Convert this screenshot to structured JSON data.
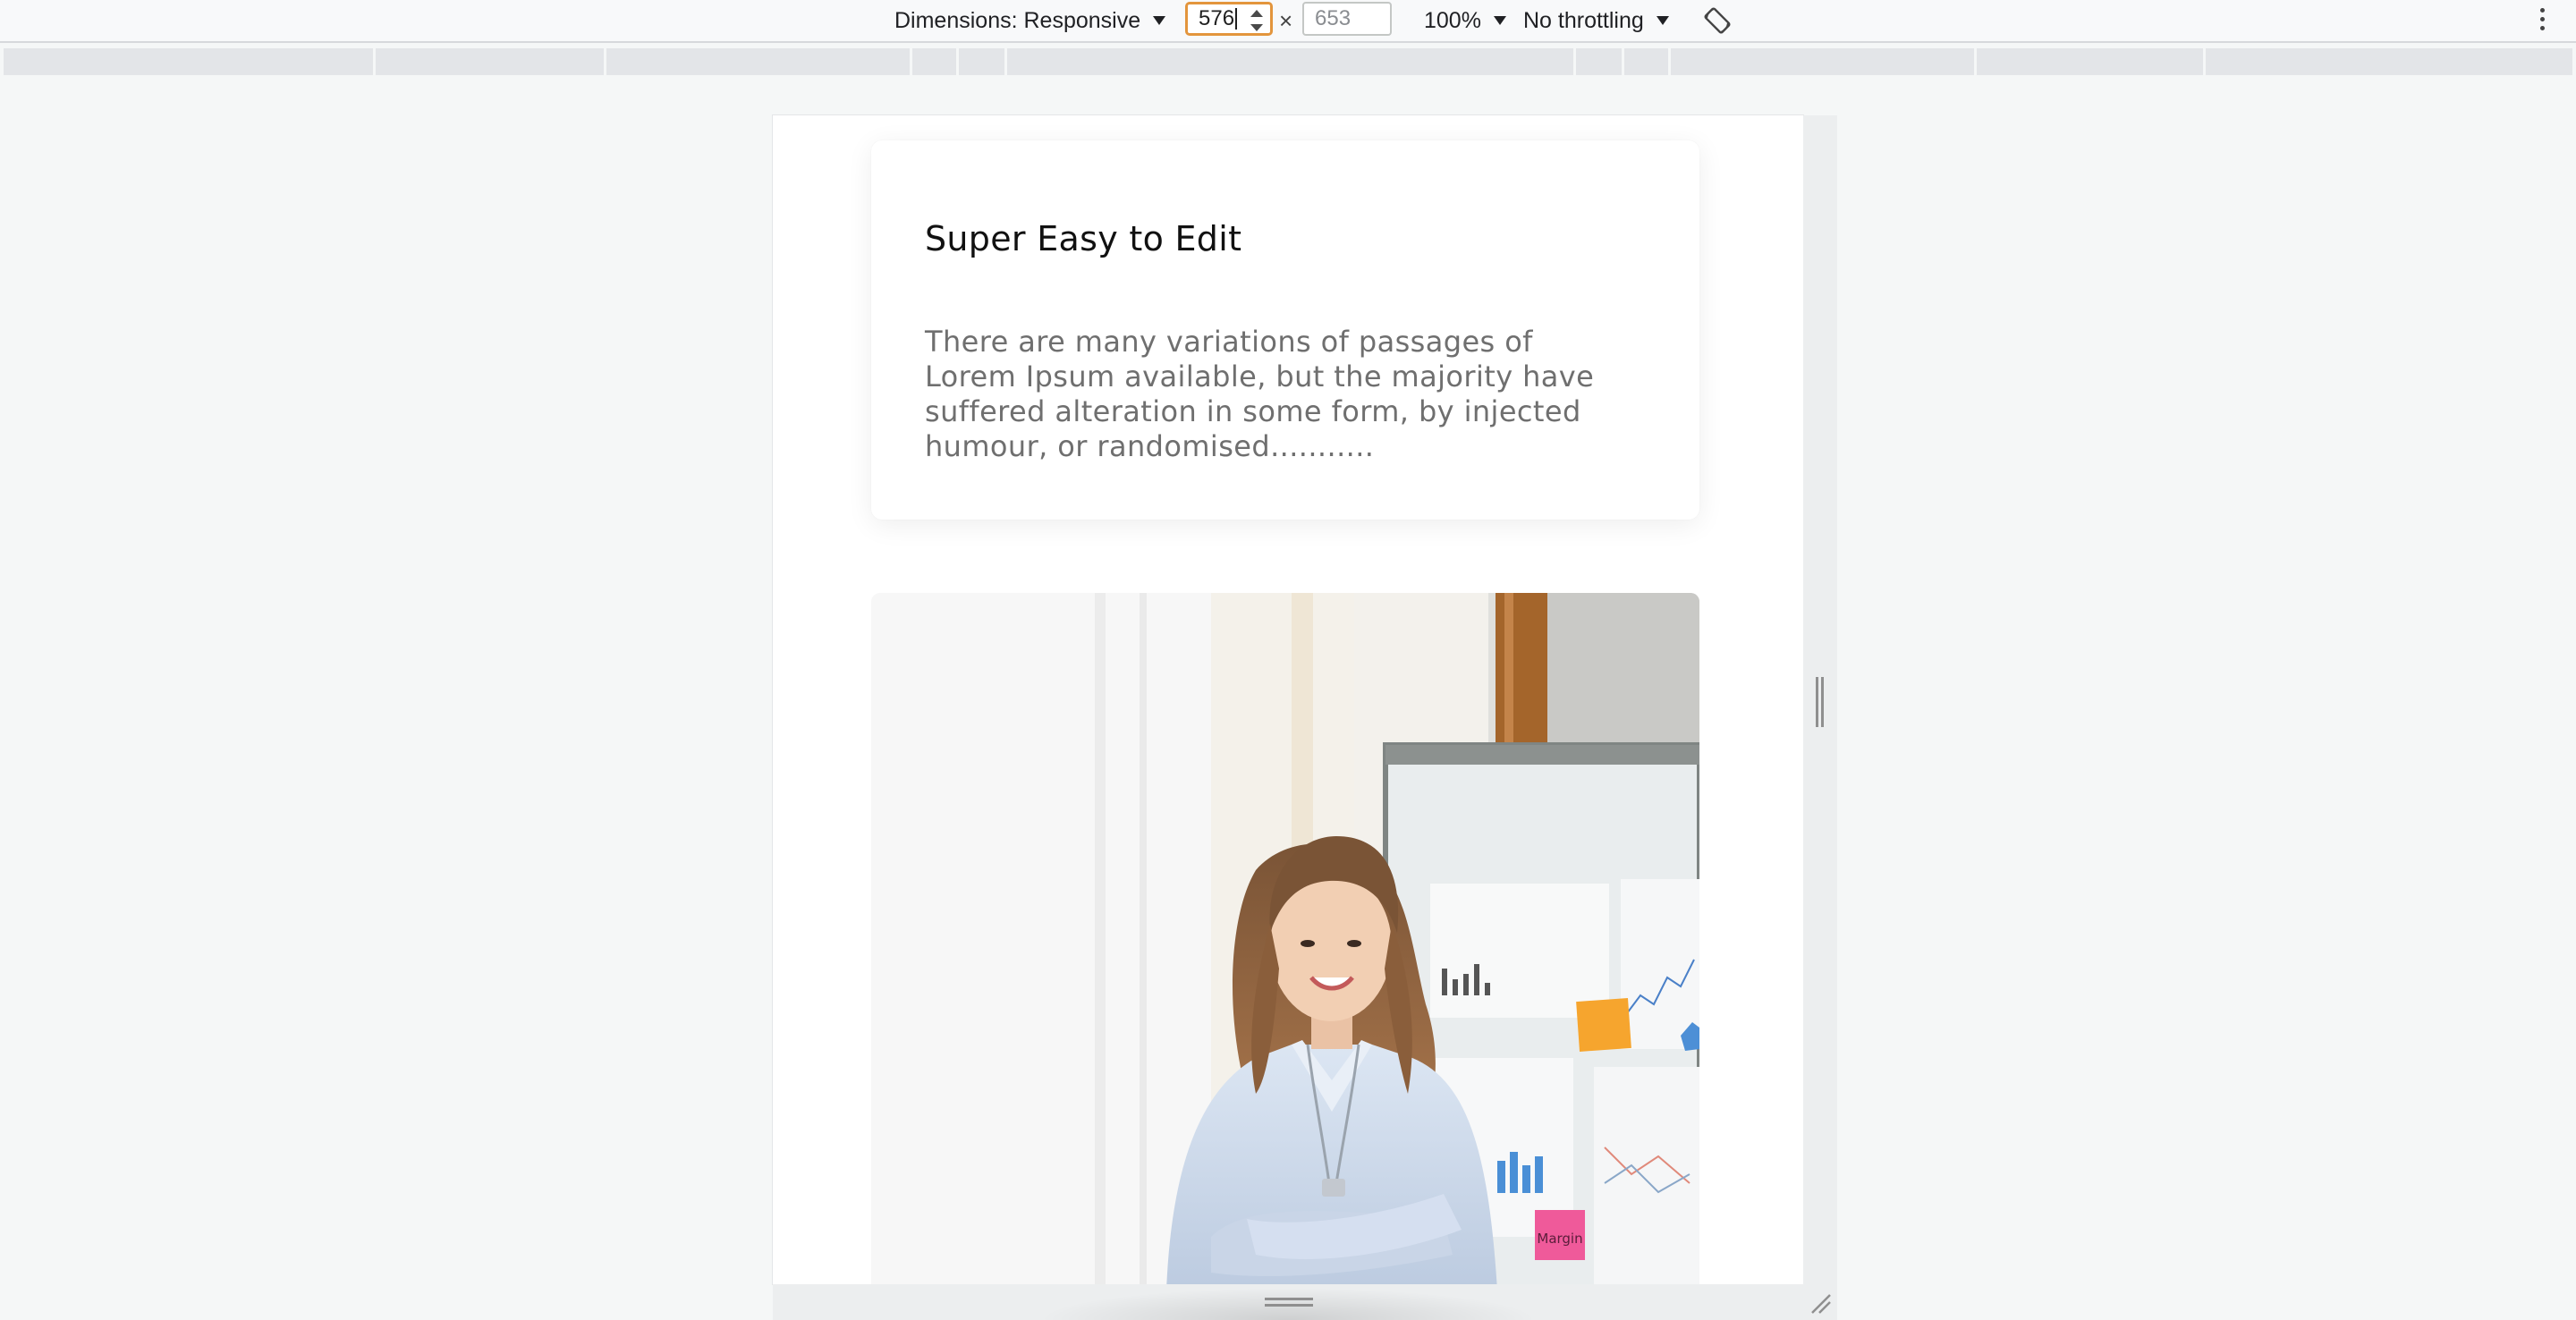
{
  "devtools": {
    "dimensions_label": "Dimensions: Responsive",
    "width_value": "576",
    "height_placeholder": "653",
    "times_symbol": "×",
    "zoom": "100%",
    "throttling": "No throttling",
    "focus_color": "#e3953c"
  },
  "icons": {
    "rotate": "rotate-icon",
    "more": "more-vertical-icon",
    "resize_side": "resize-handle-icon",
    "resize_bottom": "resize-handle-icon",
    "resize_corner": "resize-corner-icon"
  },
  "page": {
    "card": {
      "title": "Super Easy to Edit",
      "text": "There are many variations of passages of Lorem Ipsum available, but the majority have suffered alteration in some form, by injected humour, or randomised..........."
    },
    "photo": {
      "alt": "Smiling woman with crossed arms in front of a whiteboard with charts",
      "sticky_note_text": "Margin"
    }
  }
}
